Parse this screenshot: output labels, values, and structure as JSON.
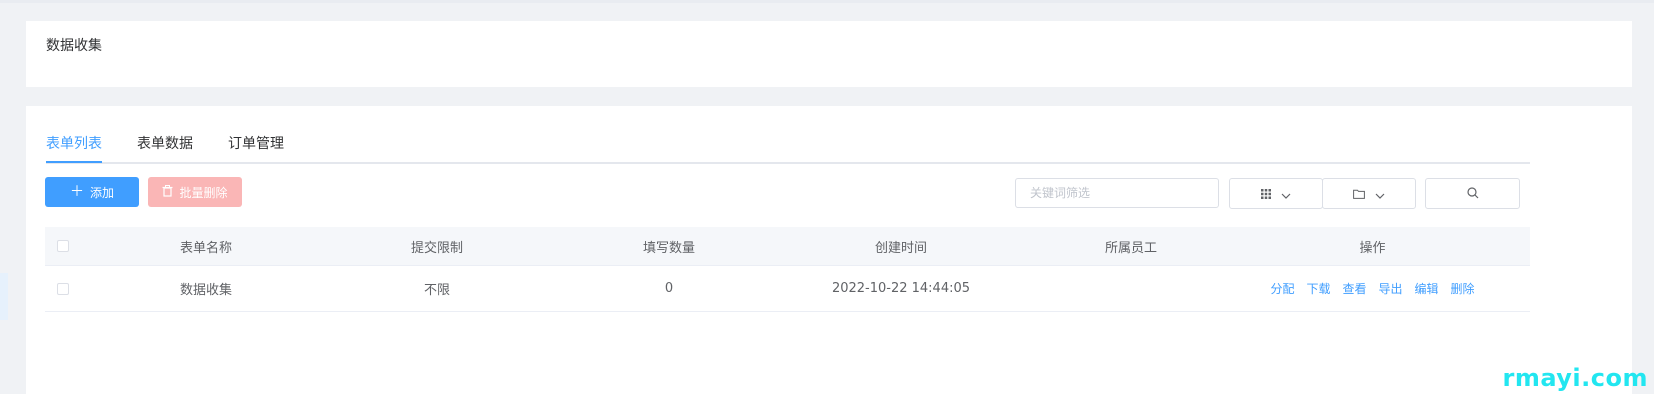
{
  "page": {
    "title": "数据收集"
  },
  "tabs": [
    {
      "label": "表单列表",
      "active": true
    },
    {
      "label": "表单数据",
      "active": false
    },
    {
      "label": "订单管理",
      "active": false
    }
  ],
  "toolbar": {
    "add_label": "添加",
    "add_icon": "plus-icon",
    "batch_delete_label": "批量删除",
    "batch_delete_icon": "trash-icon",
    "search_placeholder": "关键词筛选",
    "grid_icon": "grid-icon",
    "folder_icon": "folder-icon",
    "search_icon": "search-icon"
  },
  "table": {
    "columns": [
      "表单名称",
      "提交限制",
      "填写数量",
      "创建时间",
      "所属员工",
      "操作"
    ],
    "rows": [
      {
        "name": "数据收集",
        "limit": "不限",
        "count": "0",
        "created": "2022-10-22 14:44:05",
        "owner": "",
        "actions": [
          "分配",
          "下载",
          "查看",
          "导出",
          "编辑",
          "删除"
        ]
      }
    ]
  },
  "watermark": "rmayi.com",
  "colors": {
    "primary": "#409eff",
    "danger_disabled": "#fab6b6",
    "watermark": "#22e6f0"
  }
}
